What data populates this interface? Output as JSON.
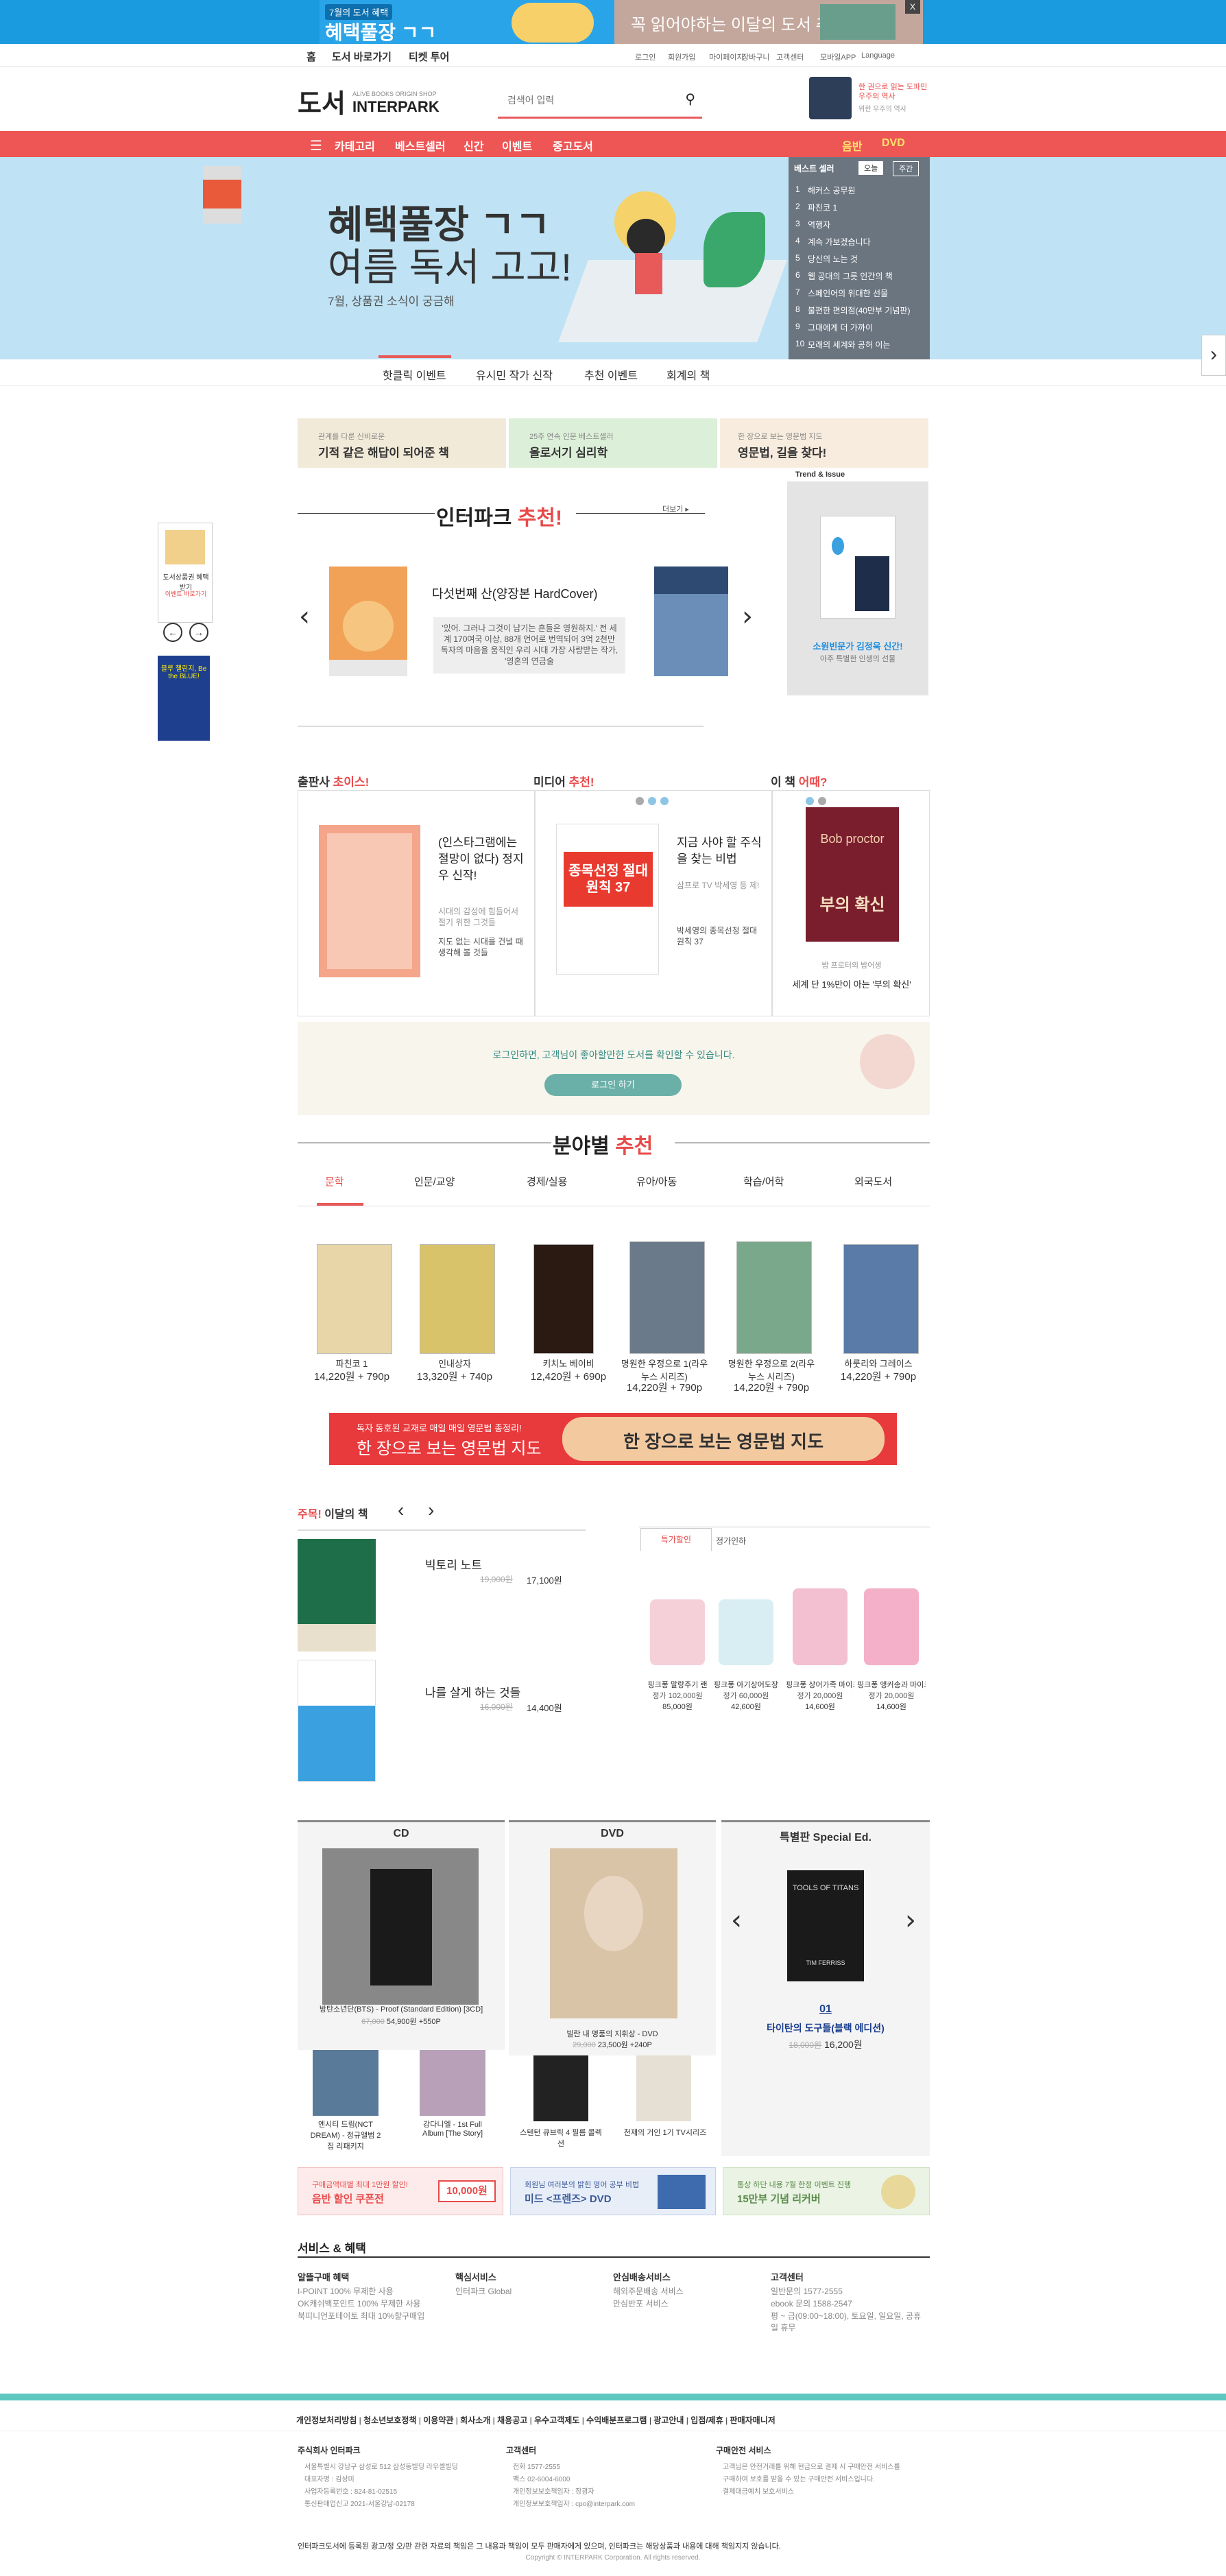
{
  "topbanner": {
    "left_small": "7월의 도서 혜택",
    "left_big": "혜택풀장 ㄱㄱ",
    "right_big": "꼭 읽어야하는 이달의 도서 추천",
    "close": "X"
  },
  "util": {
    "tabs": [
      "홈",
      "도서 바로가기",
      "티켓 투어"
    ],
    "links": [
      "로그인",
      "회원가입",
      "마이페이지",
      "장바구니",
      "고객센터",
      "모바일APP",
      "Language"
    ]
  },
  "header": {
    "logo": "도서",
    "brand": "INTERPARK",
    "brand_sub": "ALIVE BOOKS ORIGIN SHOP",
    "search_placeholder": "검색어 입력",
    "ad_text": "한 권으로 읽는 도파민 우주의 역사",
    "ad_sub": "위한 우주의 역사"
  },
  "nav": {
    "items": [
      "카테고리",
      "베스트셀러",
      "신간",
      "이벤트",
      "중고도서"
    ],
    "right": [
      "음반",
      "DVD"
    ]
  },
  "hero": {
    "title1": "혜택풀장 ㄱㄱ",
    "title2": "여름 독서 고고!",
    "sub": "7월, 상품권 소식이 궁금해"
  },
  "best": {
    "title": "베스트 셀러",
    "tabs": [
      "오늘",
      "주간"
    ],
    "items": [
      "해커스 공무원",
      "파친코 1",
      "역행자",
      "계속 가보겠습니다",
      "당신의 노는 것",
      "웹 공대의 그릇 인간의 책",
      "스페인어의 위대한 선물",
      "불편한 편의점(40만부 기념판)",
      "그대에게 더 가까이",
      "모래의 세계와 공허 이는"
    ]
  },
  "hero_tabs": [
    "핫클릭 이벤트",
    "유시민 작가 신작",
    "추천 이벤트",
    "회계의 책"
  ],
  "promo": [
    {
      "small": "관계를 다룬 신비로운",
      "big": "기적 같은 해답이 되어준 책"
    },
    {
      "small": "25주 연속 인문 베스트셀러",
      "big": "올로서기 심리학"
    },
    {
      "small": "한 장으로 보는 영문법 지도",
      "big": "영문법, 길을 찾다!"
    }
  ],
  "recommend": {
    "title_a": "인터파크 ",
    "title_b": "추천!",
    "more": "더보기 ▸",
    "book_title": "다섯번째 산(양장본 HardCover)",
    "book_desc": "'있어. 그러나 그것이 남기는 흔들은 영원하지.' 전 세계 170여국 이상, 88개 언어로 번역되어 3억 2천만 독자의 마음을 움직인 우리 시대 가장 사랑받는 작가, '영혼의 연금술",
    "prev": "‹",
    "next": "›"
  },
  "trend": {
    "title": "Trend & Issue",
    "caption": "소원빈문가 김정욱 신간!",
    "sub": "아주 특별한 인생의 선물"
  },
  "left_ad": {
    "label": "도서상품권 혜택 받기",
    "sub": "이벤트 바로가기",
    "blue": "블루 챌린지, Be the BLUE!"
  },
  "triple": [
    {
      "title_a": "출판사 ",
      "title_b": "초이스!",
      "heading": "(인스타그램에는 절망이 없다) 정지우 신작!",
      "desc": "시대의 감성에 힘들어서 절기 위한 그것들",
      "desc2": "지도 없는 시대를 건널 때 생각해 볼 것들"
    },
    {
      "title_a": "미디어 ",
      "title_b": "추천!",
      "heading": "지금 사야 할 주식을 찾는 비법",
      "desc": "삼프로 TV 박세영 등 제!",
      "desc2": "박세영의 종목선정 절대원칙 37",
      "cover": "종목선정 절대원칙 37"
    },
    {
      "title_a": "이 책 ",
      "title_b": "어때?",
      "heading": "세계 단 1%만이 아는 '부의 확신'",
      "desc": "밥 프로터의 밥어생",
      "cover_top": "Bob proctor",
      "cover": "부의 확신"
    }
  ],
  "login_box": {
    "text": "로그인하면, 고객님이 좋아할만한 도서를 확인할 수 있습니다.",
    "btn": "로그인 하기"
  },
  "genre": {
    "title_a": "분야별 ",
    "title_b": "추천",
    "tabs": [
      "문학",
      "인문/교양",
      "경제/실용",
      "유아/아동",
      "학습/어학",
      "외국도서"
    ],
    "books": [
      {
        "title": "파친코 1",
        "price": "14,220원 + 790p"
      },
      {
        "title": "인내상자",
        "price": "13,320원 + 740p"
      },
      {
        "title": "키치노 베이비",
        "price": "12,420원 + 690p"
      },
      {
        "title": "명원한 우정으로 1(라우누스 시리즈)",
        "price": "14,220원 + 790p"
      },
      {
        "title": "명원한 우정으로 2(라우누스 시리즈)",
        "price": "14,220원 + 790p"
      },
      {
        "title": "하룻리와 그레이스",
        "price": "14,220원 + 790p"
      }
    ]
  },
  "wide_ad": {
    "small": "독자 동호된 교재로 매일 매일 영문법 총정리!",
    "big": "한 장으로 보는 영문법 지도",
    "right": "한 장으로 보는 영문법 지도"
  },
  "monthly": {
    "title_a": "주목! ",
    "title_b": "이달의 책",
    "books": [
      {
        "title": "빅토리 노트",
        "old": "19,000원",
        "price": "17,100원"
      },
      {
        "title": "나를 살게 하는 것들",
        "old": "16,000원",
        "price": "14,400원"
      }
    ]
  },
  "special": {
    "tabs": [
      "특가할인",
      "정가인하"
    ],
    "items": [
      {
        "name": "핑크퐁 말랑주기 랜",
        "p1": "정가 102,000원",
        "p2": "85,000원"
      },
      {
        "name": "핑크퐁 아기상어도장",
        "p1": "정가 60,000원",
        "p2": "42,600원"
      },
      {
        "name": "핑크퐁 상어가족 마이크",
        "p1": "정가 20,000원",
        "p2": "14,600원"
      },
      {
        "name": "핑크퐁 앵커송과 마이크",
        "p1": "정가 20,000원",
        "p2": "14,600원"
      }
    ]
  },
  "media": [
    {
      "title": "CD",
      "main": "방탄소년단(BTS) - Proof (Standard Edition) [3CD]",
      "old": "67,000",
      "price": "54,900원 +550P",
      "subs": [
        "엔시티 드림(NCT DREAM) - 정규앨범 2집 리패키지",
        "강다니엘 - 1st Full Album [The Story]"
      ]
    },
    {
      "title": "DVD",
      "main": "빌란 내 명품의 지휘상 - DVD",
      "old": "29,000",
      "price": "23,500원 +240P",
      "subs": [
        "스텐턴 큐브릭 4 필름 콜렉션",
        "천재의 거인 1기 TV시리즈"
      ]
    },
    {
      "title": "특별판 Special Ed.",
      "num": "01",
      "main": "타이탄의 도구들(블랙 에디션)",
      "old": "18,000원",
      "price": "16,200원",
      "cover_top": "TOOLS OF TITANS",
      "cover_author": "TIM FERRISS"
    }
  ],
  "bottom_ads": [
    {
      "small": "구매금액대별 최대 1만원 할인!",
      "big": "음반 할인 쿠폰전",
      "badge": "10,000원"
    },
    {
      "small": "회원님 여러분의 밝힌 영어 공부 비법",
      "big": "미드 <프렌즈> DVD"
    },
    {
      "small": "통상 하단 내용 7월 한정 이벤트 진행",
      "big": "15만부 기념 리커버"
    }
  ],
  "services": {
    "title": "서비스 & 혜택",
    "cols": [
      {
        "h": "알뜰구매 혜택",
        "lines": [
          "I-POINT 100% 무제한 사용",
          "OK캐쉬백포인트 100% 무제한 사용",
          "북피니언포테이토 최대 10%할구매입"
        ]
      },
      {
        "h": "핵심서비스",
        "lines": [
          "인터파크 Global"
        ]
      },
      {
        "h": "안심배송서비스",
        "lines": [
          "해외주문배송 서비스",
          "안심반포 서비스"
        ]
      },
      {
        "h": "고객센터",
        "lines": [
          "일반문의 1577-2555",
          "ebook 문의 1588-2547",
          "평 ~ 금(09:00~18:00), 토요일, 일요일, 공휴일 휴무"
        ]
      }
    ]
  },
  "footer": {
    "links": [
      "개인정보처리방침",
      "청소년보호정책",
      "이용약관",
      "회사소개",
      "채용공고",
      "우수고객제도",
      "수익배분프로그램",
      "광고안내",
      "입점/제휴",
      "판매자매니저"
    ],
    "cols": [
      {
        "h": "주식회사 인터파크",
        "lines": [
          "서울특별시 강남구 삼성로 512 삼성동빌딩 라우셀빌딩",
          "대표자명 : 김상미",
          "사업자등록번호 : 824-81-02515",
          "통신판매업신고 2021-서울강남-02178"
        ]
      },
      {
        "h": "고객센터",
        "lines": [
          "전화 1577-2555",
          "팩스 02-6004-6000",
          "개인정보보호책임자 : 장광자",
          "개인정보보호책임자 : cpo@interpark.com"
        ]
      },
      {
        "h": "구매안전 서비스",
        "lines": [
          "고객님은 안전거래를 위해 현금으로 결제 시 구매안전 서비스를",
          "구매하여 보호를 받을 수 있는 구매안전 서비스입니다.",
          "결제대금예치 보호서비스"
        ]
      }
    ],
    "notice": "인터파크도서에 등록된 광고/정 오/판 관련 자료의 책임은 그 내용과 책임이 모두 판매자에게 있으며, 인터파크는 해당상품과 내용에 대해 책임지지 않습니다.",
    "copy": "Copyright © INTERPARK Corporation. All rights reserved."
  },
  "colors": {
    "accent": "#ee5555",
    "sky": "#bfe3f4",
    "teal": "#5ec8c0"
  }
}
